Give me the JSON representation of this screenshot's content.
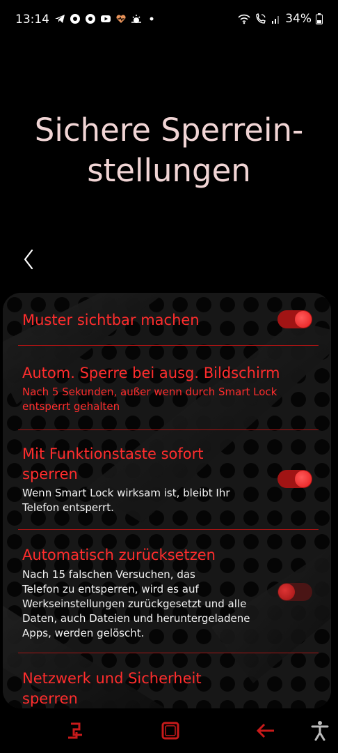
{
  "status_bar": {
    "time": "13:14",
    "battery_text": "34%",
    "icons": [
      "telegram-icon",
      "chrome-icon",
      "chrome-icon",
      "youtube-icon",
      "health-icon",
      "weather-icon",
      "dot-icon"
    ],
    "right_icons": [
      "wifi-icon",
      "wifi-call-icon",
      "signal-icon",
      "battery-icon"
    ]
  },
  "page": {
    "title_line1": "Sichere Sperrein-",
    "title_line2": "stellungen"
  },
  "settings": [
    {
      "title": "Muster sichtbar machen",
      "toggle": true
    },
    {
      "title": "Autom. Sperre bei ausg. Bildschirm",
      "subtitle_line1": "Nach 5 Sekunden, außer wenn durch Smart Lock",
      "subtitle_line2": "entsperrt gehalten"
    },
    {
      "title_line1": "Mit Funktionstaste sofort",
      "title_line2": "sperren",
      "subtitle_line1": "Wenn Smart Lock wirksam ist, bleibt Ihr",
      "subtitle_line2": "Telefon entsperrt.",
      "toggle": true
    },
    {
      "title": "Automatisch zurücksetzen",
      "subtitle_lines": [
        "Nach 15 falschen Versuchen, das",
        "Telefon zu entsperren, wird es auf",
        "Werkseinstellungen zurückgesetzt und alle",
        "Daten, auch Dateien und heruntergeladene",
        "Apps, werden gelöscht."
      ],
      "toggle": false
    },
    {
      "title_line1": "Netzwerk und Sicherheit",
      "title_line2": "sperren"
    }
  ],
  "colors": {
    "accent": "#ff2d2d",
    "title": "#f1d5d5",
    "background": "#000000"
  }
}
